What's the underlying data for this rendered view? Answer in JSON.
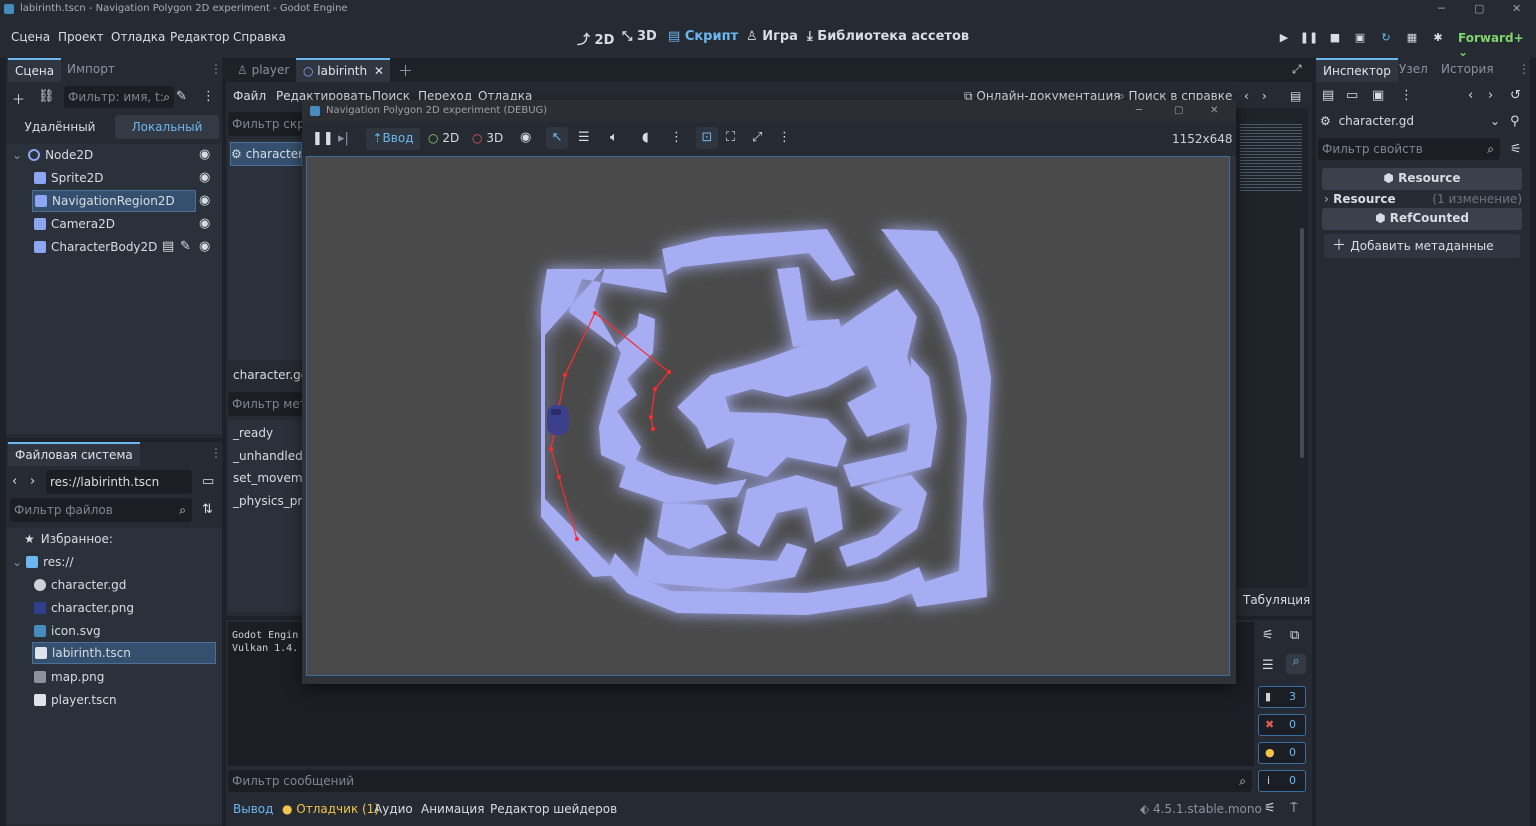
{
  "window": {
    "title": "labirinth.tscn - Navigation Polygon 2D experiment - Godot Engine"
  },
  "menu": [
    "Сцена",
    "Проект",
    "Отладка",
    "Редактор",
    "Справка"
  ],
  "workspaces": [
    {
      "icon": "2d-icon",
      "label": "2D"
    },
    {
      "icon": "3d-icon",
      "label": "3D"
    },
    {
      "icon": "script-icon",
      "label": "Скрипт"
    },
    {
      "icon": "game-icon",
      "label": "Игра"
    },
    {
      "icon": "assetlib-icon",
      "label": "Библиотека ассетов"
    }
  ],
  "renderer": "Forward+",
  "scene_panel": {
    "tabs": [
      "Сцена",
      "Импорт"
    ],
    "filter_placeholder": "Фильтр: имя, t:",
    "remote": "Удалённый",
    "local": "Локальный",
    "nodes": [
      "Node2D",
      "Sprite2D",
      "NavigationRegion2D",
      "Camera2D",
      "CharacterBody2D"
    ]
  },
  "fs_panel": {
    "tab": "Файловая система",
    "path": "res://labirinth.tscn",
    "filter_placeholder": "Фильтр файлов",
    "favorites": "Избранное:",
    "root": "res://",
    "files": [
      "character.gd",
      "character.png",
      "icon.svg",
      "labirinth.tscn",
      "map.png",
      "player.tscn"
    ]
  },
  "editor_tabs": [
    "player",
    "labirinth"
  ],
  "script_menu": [
    "Файл",
    "Редактировать",
    "Поиск",
    "Переход",
    "Отладка"
  ],
  "online_docs": "Онлайн-документация",
  "search_help": "Поиск в справке",
  "script_list": {
    "filter": "Фильтр скри",
    "item": "character.",
    "current": "character.gd",
    "methods_filter": "Фильтр мето",
    "methods": [
      "_ready",
      "_unhandled_",
      "set_moveme",
      "_physics_pro"
    ]
  },
  "output": {
    "lines": [
      "Godot Engin",
      "Vulkan 1.4."
    ],
    "filter": "Фильтр сообщений",
    "counts": [
      "3",
      "0",
      "0",
      "0"
    ]
  },
  "bottom_tabs": [
    "Вывод",
    "Отладчик (1)",
    "Аудио",
    "Анимация",
    "Редактор шейдеров"
  ],
  "version": "4.5.1.stable.mono",
  "tabulation": "Табуляция",
  "debug_window": {
    "title": "Navigation Polygon 2D experiment (DEBUG)",
    "input": "Ввод",
    "b2d": "2D",
    "b3d": "3D",
    "resolution": "1152x648"
  },
  "inspector": {
    "tabs": [
      "Инспектор",
      "Узел",
      "История"
    ],
    "resource": "character.gd",
    "filter": "Фильтр свойств",
    "section1": "Resource",
    "prop": "Resource",
    "prop_value": "(1 изменение)",
    "section2": "RefCounted",
    "add_meta": "Добавить метаданные"
  }
}
